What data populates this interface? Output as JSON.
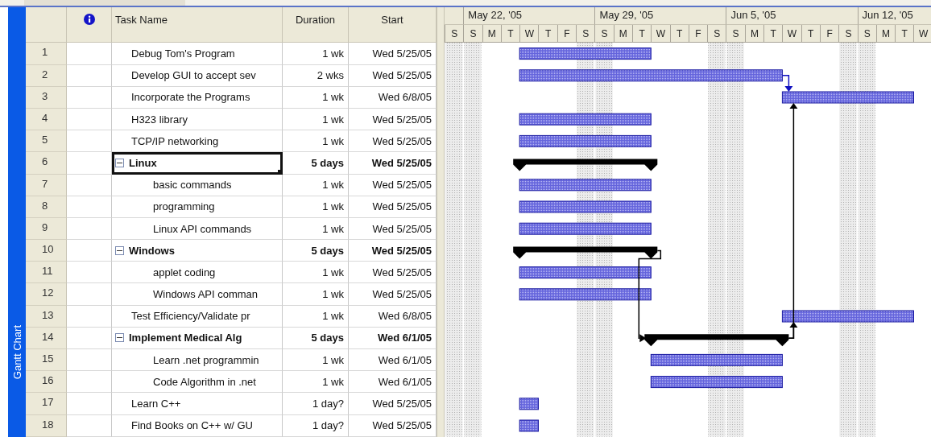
{
  "side_tab": {
    "label": "Gantt Chart"
  },
  "columns": {
    "task_name": "Task Name",
    "duration": "Duration",
    "start": "Start"
  },
  "timescale": {
    "weeks": [
      {
        "label": "May 22, '05"
      },
      {
        "label": "May 29, '05"
      },
      {
        "label": "Jun 5, '05"
      },
      {
        "label": "Jun 12, '05"
      }
    ],
    "days": [
      {
        "letter": "S",
        "weekend": true
      },
      {
        "letter": "S",
        "weekend": true
      },
      {
        "letter": "M",
        "weekend": false
      },
      {
        "letter": "T",
        "weekend": false
      },
      {
        "letter": "W",
        "weekend": false
      },
      {
        "letter": "T",
        "weekend": false
      },
      {
        "letter": "F",
        "weekend": false
      },
      {
        "letter": "S",
        "weekend": true
      },
      {
        "letter": "S",
        "weekend": true
      },
      {
        "letter": "M",
        "weekend": false
      },
      {
        "letter": "T",
        "weekend": false
      },
      {
        "letter": "W",
        "weekend": false
      },
      {
        "letter": "T",
        "weekend": false
      },
      {
        "letter": "F",
        "weekend": false
      },
      {
        "letter": "S",
        "weekend": true
      },
      {
        "letter": "S",
        "weekend": true
      },
      {
        "letter": "M",
        "weekend": false
      },
      {
        "letter": "T",
        "weekend": false
      },
      {
        "letter": "W",
        "weekend": false
      },
      {
        "letter": "T",
        "weekend": false
      },
      {
        "letter": "F",
        "weekend": false
      },
      {
        "letter": "S",
        "weekend": true
      },
      {
        "letter": "S",
        "weekend": true
      },
      {
        "letter": "M",
        "weekend": false
      },
      {
        "letter": "T",
        "weekend": false
      },
      {
        "letter": "W",
        "weekend": false
      }
    ]
  },
  "tasks": [
    {
      "id": "1",
      "kind": "task",
      "name": "Debug Tom's Program",
      "duration": "1 wk",
      "start": "Wed 5/25/05",
      "selected": false
    },
    {
      "id": "2",
      "kind": "task",
      "name": "Develop GUI to accept sev",
      "duration": "2 wks",
      "start": "Wed 5/25/05",
      "selected": false
    },
    {
      "id": "3",
      "kind": "task",
      "name": "Incorporate the Programs",
      "duration": "1 wk",
      "start": "Wed 6/8/05",
      "selected": false
    },
    {
      "id": "4",
      "kind": "task",
      "name": "H323 library",
      "duration": "1 wk",
      "start": "Wed 5/25/05",
      "selected": false
    },
    {
      "id": "5",
      "kind": "task",
      "name": "TCP/IP networking",
      "duration": "1 wk",
      "start": "Wed 5/25/05",
      "selected": false
    },
    {
      "id": "6",
      "kind": "summary",
      "name": "Linux",
      "duration": "5 days",
      "start": "Wed 5/25/05",
      "selected": true,
      "expanded": true,
      "children": [
        {
          "id": "7",
          "kind": "task",
          "name": "basic commands",
          "duration": "1 wk",
          "start": "Wed 5/25/05",
          "selected": false
        },
        {
          "id": "8",
          "kind": "task",
          "name": "programming",
          "duration": "1 wk",
          "start": "Wed 5/25/05",
          "selected": false
        },
        {
          "id": "9",
          "kind": "task",
          "name": "Linux API commands",
          "duration": "1 wk",
          "start": "Wed 5/25/05",
          "selected": false
        }
      ]
    },
    {
      "id": "10",
      "kind": "summary",
      "name": "Windows",
      "duration": "5 days",
      "start": "Wed 5/25/05",
      "selected": false,
      "expanded": true,
      "children": [
        {
          "id": "11",
          "kind": "task",
          "name": "applet coding",
          "duration": "1 wk",
          "start": "Wed 5/25/05",
          "selected": false
        },
        {
          "id": "12",
          "kind": "task",
          "name": "Windows API comman",
          "duration": "1 wk",
          "start": "Wed 5/25/05",
          "selected": false
        }
      ]
    },
    {
      "id": "13",
      "kind": "task",
      "name": "Test Efficiency/Validate pr",
      "duration": "1 wk",
      "start": "Wed 6/8/05",
      "selected": false
    },
    {
      "id": "14",
      "kind": "summary",
      "name": "Implement Medical  Alg",
      "duration": "5 days",
      "start": "Wed 6/1/05",
      "selected": false,
      "expanded": true,
      "children": [
        {
          "id": "15",
          "kind": "task",
          "name": "Learn .net programmin",
          "duration": "1 wk",
          "start": "Wed 6/1/05",
          "selected": false
        },
        {
          "id": "16",
          "kind": "task",
          "name": "Code Algorithm in .net",
          "duration": "1 wk",
          "start": "Wed 6/1/05",
          "selected": false
        }
      ]
    },
    {
      "id": "17",
      "kind": "task",
      "name": "Learn C++",
      "duration": "1 day?",
      "start": "Wed 5/25/05",
      "selected": false
    },
    {
      "id": "18",
      "kind": "task",
      "name": "Find Books on C++  w/ GU",
      "duration": "1 day?",
      "start": "Wed 5/25/05",
      "selected": false
    }
  ]
}
